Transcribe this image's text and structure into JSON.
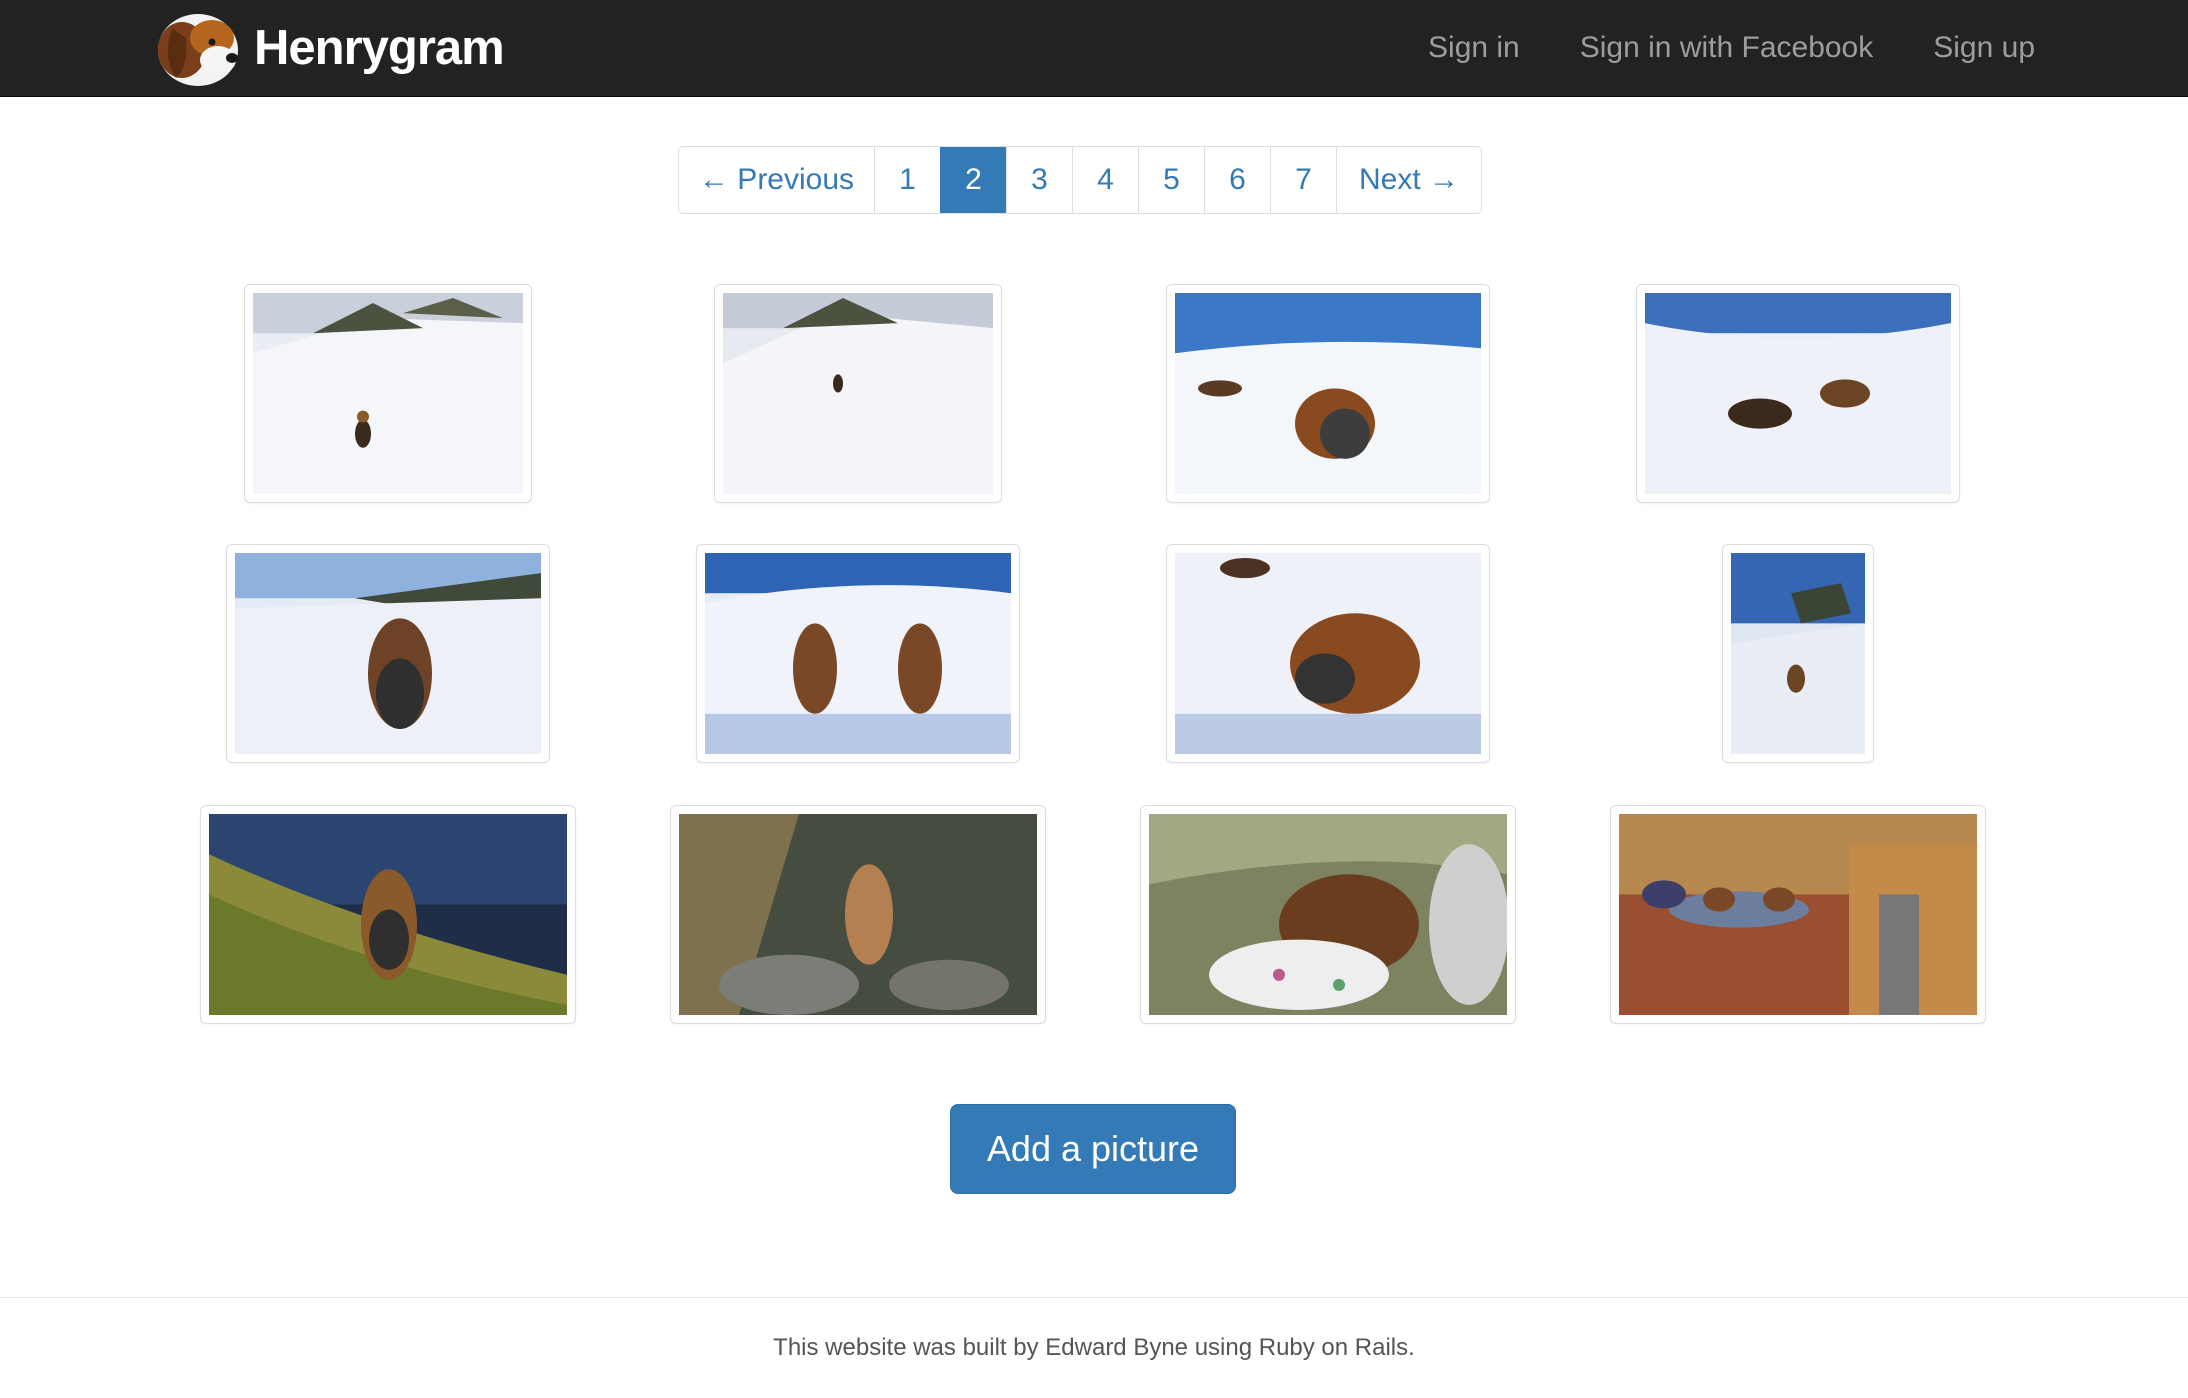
{
  "navbar": {
    "brand": "Henrygram",
    "links": [
      "Sign in",
      "Sign in with Facebook",
      "Sign up"
    ]
  },
  "pagination": {
    "previous": "← Previous",
    "pages": [
      "1",
      "2",
      "3",
      "4",
      "5",
      "6",
      "7"
    ],
    "current_page": "2",
    "next": "Next →"
  },
  "actions": {
    "add_picture": "Add a picture"
  },
  "footer": {
    "text": "This website was built by Edward Byne using Ruby on Rails."
  },
  "colors": {
    "navbar_bg": "#222222",
    "link_blue": "#337ab7",
    "nav_link_grey": "#9d9d9d"
  }
}
